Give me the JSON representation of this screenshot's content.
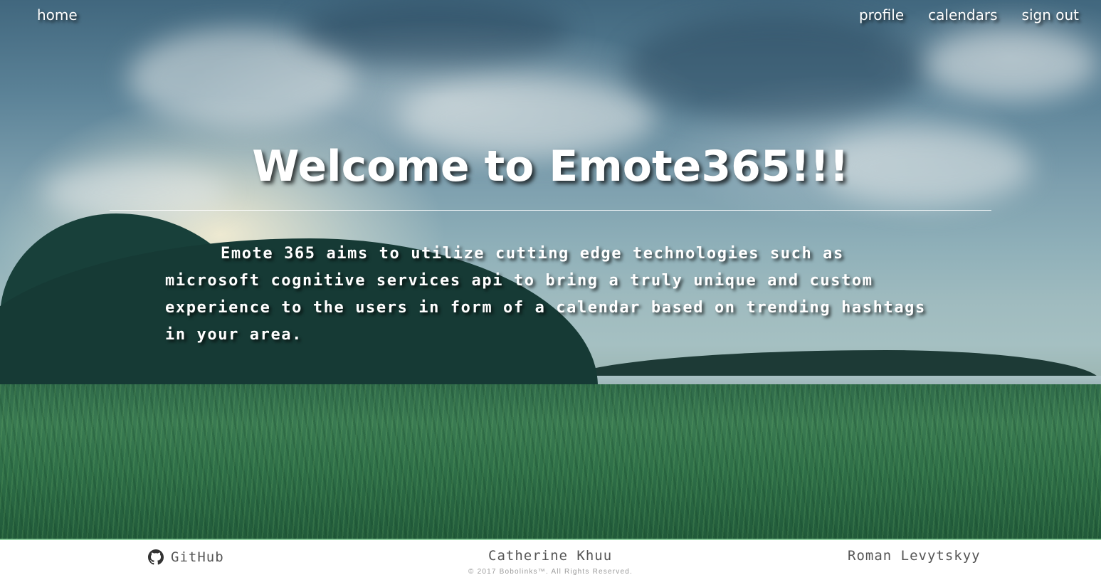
{
  "nav": {
    "home": "home",
    "profile": "profile",
    "calendars": "calendars",
    "sign_out": "sign out"
  },
  "hero": {
    "title": "Welcome to Emote365!!!",
    "intro": "Emote 365 aims to utilize cutting edge technologies such as microsoft cognitive services api to bring a truly unique and custom experience to the users in form of a calendar based on trending hashtags in your area."
  },
  "footer": {
    "github_label": "GitHub",
    "github_icon": "github-icon",
    "author_1": "Catherine Khuu",
    "author_2": "Roman Levytskyy",
    "copyright": "© 2017 Bobolinks™. All Rights Reserved."
  },
  "colors": {
    "text_light": "#ffffff",
    "footer_text": "#555555",
    "footer_border": "#8fcf9f",
    "copyright_text": "#9a9a9a"
  }
}
